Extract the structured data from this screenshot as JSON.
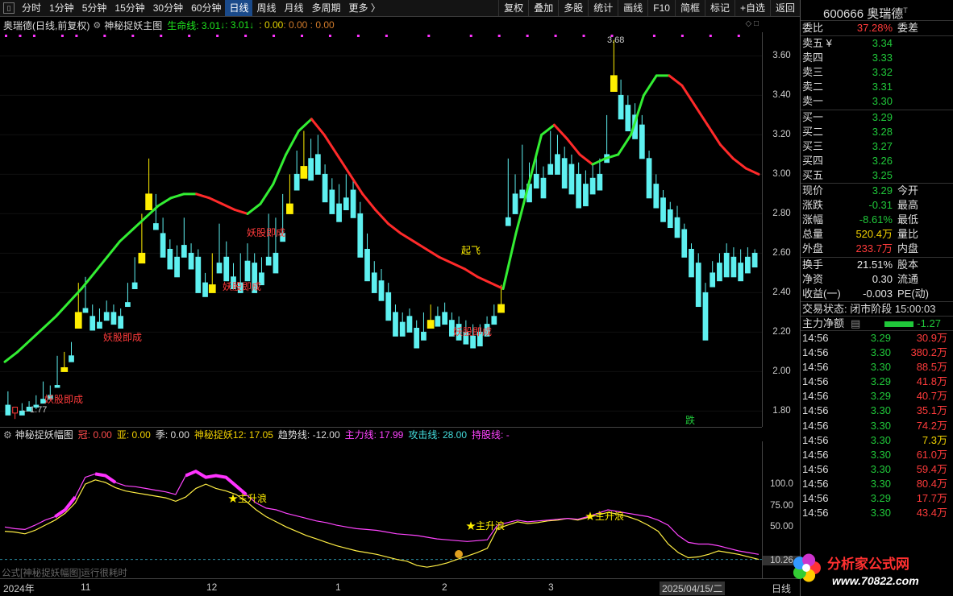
{
  "toolbar": {
    "items": [
      "分时",
      "1分钟",
      "5分钟",
      "15分钟",
      "30分钟",
      "60分钟",
      "日线",
      "周线",
      "月线",
      "多周期",
      "更多 〉"
    ],
    "active_index": 6,
    "buttons": [
      "复权",
      "叠加",
      "多股",
      "统计",
      "画线",
      "F10",
      "简框",
      "标记",
      "+自选",
      "返回"
    ]
  },
  "main_header": {
    "stock": "奥瑞德(日线,前复权)",
    "indicator": "神秘捉妖主图",
    "life_label": "生命线: 3.01",
    "life_val2": ": 3.01",
    "val3": ": 0.00",
    "val4": ": 0.00 : 0.00"
  },
  "sub_header": {
    "name": "神秘捉妖幅图",
    "guan": "冠: 0.00",
    "ya": "亚: 0.00",
    "ji": "季: 0.00",
    "shen": "神秘捉妖12: 17.05",
    "trend": "趋势线: -12.00",
    "main_line": "主力线: 17.99",
    "attack": "攻击线: 28.00",
    "hold": "持股线: -"
  },
  "main_axis": [
    "3.60",
    "3.40",
    "3.20",
    "3.00",
    "2.80",
    "2.60",
    "2.40",
    "2.20",
    "2.00",
    "1.80"
  ],
  "sub_axis": [
    "100.0",
    "75.00",
    "50.00"
  ],
  "sub_current": "10.26",
  "xaxis": {
    "labels": [
      "2024年",
      "11",
      "12",
      "1",
      "2",
      "3"
    ],
    "cursor_date": "2025/04/15/二",
    "right_label": "日线"
  },
  "annotations": {
    "demon": "妖股即成",
    "takeoff": "起飞",
    "rise": "★主升浪",
    "fall": "跌",
    "high_price": "3.68",
    "low_price": "1.77"
  },
  "status_text": "公式[神秘捉妖幅图]运行很耗时",
  "panel": {
    "code": "600666",
    "name": "奥瑞德",
    "weibi_label": "委比",
    "weibi_val": "37.28%",
    "weicha_label": "委差",
    "asks": [
      {
        "label": "卖五 ¥",
        "price": "3.34"
      },
      {
        "label": "卖四",
        "price": "3.33"
      },
      {
        "label": "卖三",
        "price": "3.32"
      },
      {
        "label": "卖二",
        "price": "3.31"
      },
      {
        "label": "卖一",
        "price": "3.30"
      }
    ],
    "bids": [
      {
        "label": "买一",
        "price": "3.29"
      },
      {
        "label": "买二",
        "price": "3.28"
      },
      {
        "label": "买三",
        "price": "3.27"
      },
      {
        "label": "买四",
        "price": "3.26"
      },
      {
        "label": "买五",
        "price": "3.25"
      }
    ],
    "stats": [
      {
        "l": "现价",
        "v": "3.29",
        "r": "今开",
        "cls": "grn"
      },
      {
        "l": "涨跌",
        "v": "-0.31",
        "r": "最高",
        "cls": "grn"
      },
      {
        "l": "涨幅",
        "v": "-8.61%",
        "r": "最低",
        "cls": "grn"
      },
      {
        "l": "总量",
        "v": "520.4万",
        "r": "量比",
        "cls": "ylw"
      },
      {
        "l": "外盘",
        "v": "233.7万",
        "r": "内盘",
        "cls": "red"
      }
    ],
    "stats2": [
      {
        "l": "换手",
        "v": "21.51%",
        "r": "股本",
        "cls": "wht"
      },
      {
        "l": "净资",
        "v": "0.30",
        "r": "流通",
        "cls": "wht"
      },
      {
        "l": "收益(一)",
        "v": "-0.003",
        "r": "PE(动)",
        "cls": "wht"
      }
    ],
    "trade_state": "交易状态: 闭市阶段 15:00:03",
    "main_net_label": "主力净额",
    "main_net_val": "-1.27",
    "trades": [
      {
        "t": "14:56",
        "p": "3.29",
        "v": "30.9万",
        "pc": "grn",
        "vc": "red"
      },
      {
        "t": "14:56",
        "p": "3.30",
        "v": "380.2万",
        "pc": "grn",
        "vc": "red"
      },
      {
        "t": "14:56",
        "p": "3.30",
        "v": "88.5万",
        "pc": "grn",
        "vc": "red"
      },
      {
        "t": "14:56",
        "p": "3.29",
        "v": "41.8万",
        "pc": "grn",
        "vc": "red"
      },
      {
        "t": "14:56",
        "p": "3.29",
        "v": "40.7万",
        "pc": "grn",
        "vc": "red"
      },
      {
        "t": "14:56",
        "p": "3.30",
        "v": "35.1万",
        "pc": "grn",
        "vc": "red"
      },
      {
        "t": "14:56",
        "p": "3.30",
        "v": "74.2万",
        "pc": "grn",
        "vc": "red"
      },
      {
        "t": "14:56",
        "p": "3.30",
        "v": "7.3万",
        "pc": "grn",
        "vc": "ylw"
      },
      {
        "t": "14:56",
        "p": "3.30",
        "v": "61.0万",
        "pc": "grn",
        "vc": "red"
      },
      {
        "t": "14:56",
        "p": "3.30",
        "v": "59.4万",
        "pc": "grn",
        "vc": "red"
      },
      {
        "t": "14:56",
        "p": "3.30",
        "v": "80.4万",
        "pc": "grn",
        "vc": "red"
      },
      {
        "t": "14:56",
        "p": "3.29",
        "v": "17.7万",
        "pc": "grn",
        "vc": "red"
      },
      {
        "t": "14:56",
        "p": "3.30",
        "v": "43.4万",
        "pc": "grn",
        "vc": "red"
      }
    ]
  },
  "logo": {
    "name": "分析家公式网",
    "url": "www.70822.com"
  },
  "colors": {
    "up": "#ff3b3b",
    "down": "#5ef0f0",
    "life_up": "#33ee33",
    "life_down": "#ff2a2a",
    "magenta": "#ff33ff",
    "yellow": "#ffee00"
  },
  "chart_data": [
    {
      "type": "candlestick",
      "ylim": [
        1.72,
        3.72
      ],
      "ohlc": [
        [
          1.83,
          1.9,
          1.79,
          1.78
        ],
        [
          1.79,
          1.82,
          1.76,
          1.82
        ],
        [
          1.8,
          1.84,
          1.79,
          1.78
        ],
        [
          1.82,
          1.85,
          1.8,
          1.8
        ],
        [
          1.83,
          1.88,
          1.81,
          1.82
        ],
        [
          1.86,
          1.95,
          1.85,
          1.84
        ],
        [
          1.88,
          1.93,
          1.87,
          1.86
        ],
        [
          1.93,
          2.08,
          1.92,
          1.92
        ],
        [
          2.02,
          2.1,
          2.0,
          2.0
        ],
        [
          2.08,
          2.15,
          2.07,
          2.05
        ],
        [
          2.3,
          2.45,
          2.28,
          2.22
        ],
        [
          2.32,
          2.48,
          2.3,
          2.3
        ],
        [
          2.28,
          2.34,
          2.22,
          2.21
        ],
        [
          2.25,
          2.32,
          2.24,
          2.22
        ],
        [
          2.3,
          2.36,
          2.27,
          2.26
        ],
        [
          2.3,
          2.34,
          2.25,
          2.24
        ],
        [
          2.28,
          2.32,
          2.23,
          2.22
        ],
        [
          2.35,
          2.45,
          2.34,
          2.33
        ],
        [
          2.45,
          2.58,
          2.43,
          2.42
        ],
        [
          2.6,
          2.8,
          2.55,
          2.55
        ],
        [
          2.9,
          3.08,
          2.88,
          2.82
        ],
        [
          2.75,
          2.9,
          2.74,
          2.72
        ],
        [
          2.7,
          2.78,
          2.6,
          2.58
        ],
        [
          2.62,
          2.67,
          2.55,
          2.52
        ],
        [
          2.58,
          2.64,
          2.5,
          2.48
        ],
        [
          2.64,
          2.78,
          2.62,
          2.58
        ],
        [
          2.6,
          2.65,
          2.54,
          2.52
        ],
        [
          2.58,
          2.62,
          2.42,
          2.4
        ],
        [
          2.45,
          2.5,
          2.4,
          2.38
        ],
        [
          2.44,
          2.6,
          2.42,
          2.4
        ],
        [
          2.55,
          2.75,
          2.53,
          2.5
        ],
        [
          2.58,
          2.66,
          2.48,
          2.46
        ],
        [
          2.48,
          2.55,
          2.44,
          2.42
        ],
        [
          2.45,
          2.6,
          2.43,
          2.4
        ],
        [
          2.56,
          2.65,
          2.48,
          2.46
        ],
        [
          2.55,
          2.6,
          2.42,
          2.4
        ],
        [
          2.5,
          2.58,
          2.48,
          2.44
        ],
        [
          2.58,
          2.8,
          2.56,
          2.54
        ],
        [
          2.6,
          2.78,
          2.52,
          2.5
        ],
        [
          2.7,
          2.9,
          2.68,
          2.66
        ],
        [
          2.85,
          3.0,
          2.82,
          2.8
        ],
        [
          3.0,
          3.12,
          2.95,
          2.92
        ],
        [
          3.04,
          3.22,
          3.0,
          2.98
        ],
        [
          3.08,
          3.18,
          3.0,
          2.97
        ],
        [
          3.1,
          3.2,
          3.02,
          3.0
        ],
        [
          3.0,
          3.05,
          2.88,
          2.86
        ],
        [
          2.92,
          2.98,
          2.82,
          2.8
        ],
        [
          2.85,
          2.95,
          2.78,
          2.76
        ],
        [
          2.88,
          3.0,
          2.84,
          2.82
        ],
        [
          2.92,
          2.98,
          2.8,
          2.78
        ],
        [
          2.8,
          2.86,
          2.6,
          2.58
        ],
        [
          2.62,
          2.7,
          2.48,
          2.46
        ],
        [
          2.5,
          2.56,
          2.42,
          2.4
        ],
        [
          2.46,
          2.52,
          2.38,
          2.36
        ],
        [
          2.4,
          2.45,
          2.28,
          2.26
        ],
        [
          2.3,
          2.34,
          2.2,
          2.18
        ],
        [
          2.25,
          2.3,
          2.2,
          2.18
        ],
        [
          2.28,
          2.32,
          2.22,
          2.2
        ],
        [
          2.22,
          2.26,
          2.14,
          2.12
        ],
        [
          2.2,
          2.3,
          2.18,
          2.16
        ],
        [
          2.26,
          2.34,
          2.24,
          2.22
        ],
        [
          2.28,
          2.33,
          2.25,
          2.23
        ],
        [
          2.3,
          2.35,
          2.26,
          2.24
        ],
        [
          2.26,
          2.3,
          2.2,
          2.18
        ],
        [
          2.24,
          2.28,
          2.18,
          2.16
        ],
        [
          2.2,
          2.26,
          2.16,
          2.14
        ],
        [
          2.18,
          2.24,
          2.14,
          2.12
        ],
        [
          2.2,
          2.24,
          2.15,
          2.13
        ],
        [
          2.24,
          2.28,
          2.2,
          2.18
        ],
        [
          2.28,
          2.34,
          2.26,
          2.24
        ],
        [
          2.34,
          2.44,
          2.32,
          2.3
        ],
        [
          2.78,
          3.08,
          2.76,
          2.74
        ],
        [
          2.9,
          3.0,
          2.82,
          2.8
        ],
        [
          2.92,
          3.15,
          2.9,
          2.88
        ],
        [
          2.95,
          3.06,
          2.88,
          2.86
        ],
        [
          3.0,
          3.1,
          2.95,
          2.93
        ],
        [
          2.98,
          3.04,
          2.9,
          2.88
        ],
        [
          3.05,
          3.22,
          3.02,
          3.0
        ],
        [
          3.1,
          3.2,
          3.02,
          3.0
        ],
        [
          3.08,
          3.14,
          2.95,
          2.93
        ],
        [
          3.05,
          3.1,
          2.92,
          2.9
        ],
        [
          3.0,
          3.06,
          2.85,
          2.83
        ],
        [
          2.95,
          3.02,
          2.86,
          2.84
        ],
        [
          2.98,
          3.05,
          2.92,
          2.9
        ],
        [
          3.0,
          3.08,
          2.94,
          2.92
        ],
        [
          3.1,
          3.3,
          3.08,
          3.06
        ],
        [
          3.5,
          3.68,
          3.45,
          3.42
        ],
        [
          3.4,
          3.48,
          3.3,
          3.28
        ],
        [
          3.35,
          3.4,
          3.25,
          3.22
        ],
        [
          3.3,
          3.36,
          3.2,
          3.18
        ],
        [
          3.25,
          3.3,
          3.1,
          3.08
        ],
        [
          3.08,
          3.12,
          2.9,
          2.88
        ],
        [
          2.95,
          3.0,
          2.85,
          2.83
        ],
        [
          2.88,
          2.92,
          2.78,
          2.76
        ],
        [
          2.82,
          2.86,
          2.75,
          2.73
        ],
        [
          2.78,
          2.84,
          2.7,
          2.68
        ],
        [
          2.72,
          2.75,
          2.6,
          2.58
        ],
        [
          2.62,
          2.65,
          2.5,
          2.48
        ],
        [
          2.55,
          2.6,
          2.35,
          2.33
        ],
        [
          2.4,
          2.45,
          2.18,
          2.16
        ],
        [
          2.5,
          2.56,
          2.45,
          2.43
        ],
        [
          2.55,
          2.6,
          2.48,
          2.46
        ],
        [
          2.6,
          2.65,
          2.5,
          2.48
        ],
        [
          2.58,
          2.63,
          2.5,
          2.48
        ],
        [
          2.55,
          2.62,
          2.48,
          2.46
        ],
        [
          2.58,
          2.63,
          2.52,
          2.5
        ],
        [
          2.6,
          2.62,
          2.55,
          2.53
        ]
      ]
    },
    {
      "type": "line",
      "name": "生命线",
      "values": [
        2.05,
        2.1,
        2.16,
        2.22,
        2.28,
        2.35,
        2.42,
        2.5,
        2.58,
        2.66,
        2.72,
        2.78,
        2.84,
        2.88,
        2.9,
        2.9,
        2.88,
        2.85,
        2.82,
        2.8,
        2.85,
        2.95,
        3.1,
        3.22,
        3.28,
        3.2,
        3.1,
        3.0,
        2.9,
        2.82,
        2.75,
        2.7,
        2.66,
        2.62,
        2.58,
        2.55,
        2.52,
        2.48,
        2.45,
        2.42,
        2.7,
        2.95,
        3.2,
        3.25,
        3.18,
        3.1,
        3.05,
        3.08,
        3.1,
        3.2,
        3.4,
        3.5,
        3.5,
        3.45,
        3.35,
        3.25,
        3.15,
        3.08,
        3.03,
        3.0
      ]
    },
    {
      "type": "line",
      "name": "主力线",
      "values": [
        50,
        48,
        47,
        52,
        58,
        62,
        70,
        85,
        108,
        112,
        110,
        102,
        98,
        97,
        95,
        93,
        91,
        88,
        110,
        115,
        108,
        110,
        108,
        98,
        88,
        78,
        72,
        70,
        66,
        63,
        60,
        57,
        55,
        52,
        50,
        48,
        47,
        46,
        44,
        42,
        41,
        40,
        38,
        36,
        35,
        34,
        33,
        34,
        35,
        52,
        55,
        58,
        56,
        57,
        58,
        59,
        60,
        59,
        62,
        66,
        70,
        68,
        66,
        64,
        62,
        58,
        52,
        40,
        32,
        30,
        30,
        28,
        25,
        22,
        20,
        18
      ]
    },
    {
      "type": "line",
      "name": "攻击线",
      "values": [
        45,
        44,
        42,
        46,
        52,
        58,
        66,
        78,
        100,
        105,
        102,
        96,
        92,
        90,
        88,
        86,
        84,
        80,
        85,
        95,
        100,
        95,
        92,
        88,
        80,
        70,
        62,
        56,
        50,
        45,
        40,
        36,
        32,
        28,
        25,
        22,
        20,
        18,
        15,
        12,
        10,
        5,
        3,
        5,
        8,
        12,
        16,
        20,
        25,
        48,
        52,
        56,
        54,
        55,
        57,
        58,
        60,
        58,
        61,
        64,
        67,
        65,
        62,
        58,
        52,
        45,
        30,
        20,
        14,
        15,
        18,
        22,
        20,
        18,
        15,
        12
      ]
    }
  ]
}
